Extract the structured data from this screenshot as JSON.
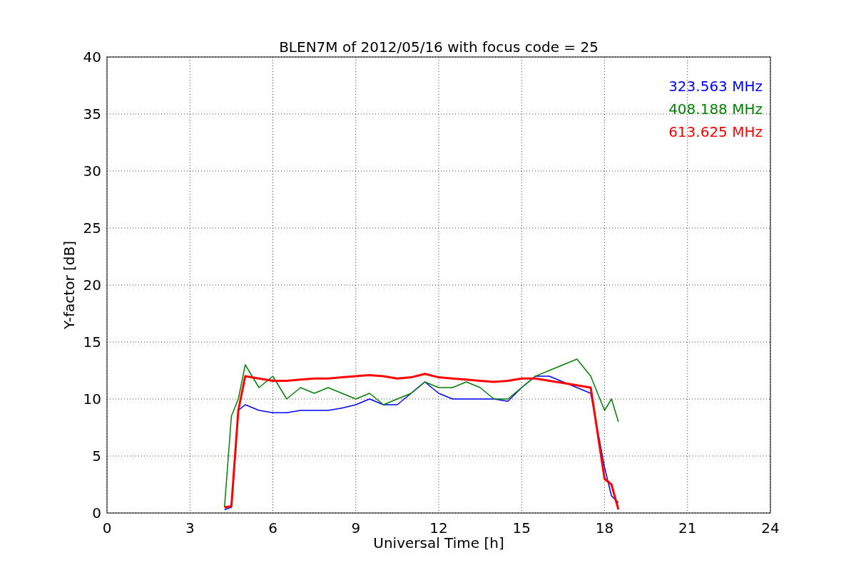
{
  "chart_data": {
    "type": "line",
    "title": "BLEN7M of 2012/05/16 with focus code = 25",
    "xlabel": "Universal Time [h]",
    "ylabel": "Y-factor [dB]",
    "x": [
      4.25,
      4.5,
      4.75,
      5,
      5.5,
      6,
      6.5,
      7,
      7.5,
      8,
      8.5,
      9,
      9.5,
      10,
      10.5,
      11,
      11.5,
      12,
      12.5,
      13,
      13.5,
      14,
      14.5,
      15,
      15.5,
      16,
      16.5,
      17,
      17.5,
      18,
      18.25,
      18.5
    ],
    "series": [
      {
        "name": "323.563 MHz",
        "color": "#0000ff",
        "values": [
          0.3,
          0.5,
          9,
          9.5,
          9,
          8.8,
          8.8,
          9,
          9,
          9,
          9.2,
          9.5,
          10,
          9.5,
          9.5,
          10.5,
          11.5,
          10.5,
          10,
          10,
          10,
          10,
          9.8,
          11,
          12,
          12,
          11.5,
          11,
          10.5,
          4,
          1.5,
          0.9
        ]
      },
      {
        "name": "408.188 MHz",
        "color": "#008000",
        "values": [
          0.5,
          8.5,
          10,
          13,
          11,
          12,
          10,
          11,
          10.5,
          11,
          10.5,
          10,
          10.5,
          9.5,
          10,
          10.5,
          11.5,
          11,
          11,
          11.5,
          11,
          10,
          10,
          11,
          12,
          12.5,
          13,
          13.5,
          12,
          9,
          10,
          8
        ]
      },
      {
        "name": "613.625 MHz",
        "color": "#ff0000",
        "values": [
          0.5,
          0.6,
          9,
          12,
          11.8,
          11.6,
          11.6,
          11.7,
          11.8,
          11.8,
          11.9,
          12,
          12.1,
          12,
          11.8,
          11.9,
          12.2,
          11.9,
          11.8,
          11.7,
          11.6,
          11.5,
          11.6,
          11.8,
          11.8,
          11.6,
          11.4,
          11.2,
          11,
          3,
          2.5,
          0.3
        ]
      }
    ],
    "xlim": [
      0,
      24
    ],
    "ylim": [
      0,
      40
    ],
    "xticks": [
      0,
      3,
      6,
      9,
      12,
      15,
      18,
      21,
      24
    ],
    "yticks": [
      0,
      5,
      10,
      15,
      20,
      25,
      30,
      35,
      40
    ],
    "grid": true
  }
}
